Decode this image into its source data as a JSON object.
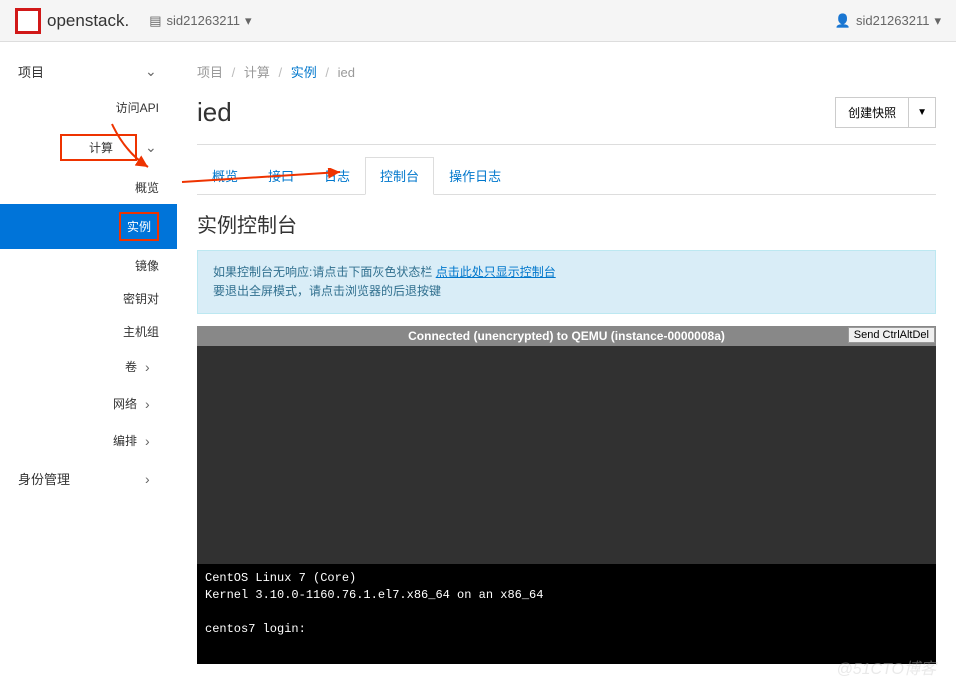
{
  "topbar": {
    "logo_text": "openstack.",
    "project_name": "sid21263211",
    "user_name": "sid21263211"
  },
  "sidebar": {
    "project": "项目",
    "access_api": "访问API",
    "compute": "计算",
    "compute_items": {
      "overview": "概览",
      "instances": "实例",
      "images": "镜像",
      "keypairs": "密钥对",
      "hostgroups": "主机组"
    },
    "volumes": "卷",
    "network": "网络",
    "orchestration": "编排",
    "identity": "身份管理"
  },
  "breadcrumb": {
    "project": "项目",
    "compute": "计算",
    "instances": "实例",
    "current": "ied"
  },
  "page_title": "ied",
  "snapshot_button": "创建快照",
  "tabs": {
    "overview": "概览",
    "interfaces": "接口",
    "log": "日志",
    "console": "控制台",
    "actionlog": "操作日志"
  },
  "console": {
    "title": "实例控制台",
    "alert_line1_pre": "如果控制台无响应:请点击下面灰色状态栏",
    "alert_link": "点击此处只显示控制台",
    "alert_line2": "要退出全屏模式，请点击浏览器的后退按键",
    "header": "Connected (unencrypted) to QEMU (instance-0000008a)",
    "send_cad": "Send CtrlAltDel",
    "terminal_text": "CentOS Linux 7 (Core)\nKernel 3.10.0-1160.76.1.el7.x86_64 on an x86_64\n\ncentos7 login:"
  },
  "watermark": "@51CTO博客"
}
